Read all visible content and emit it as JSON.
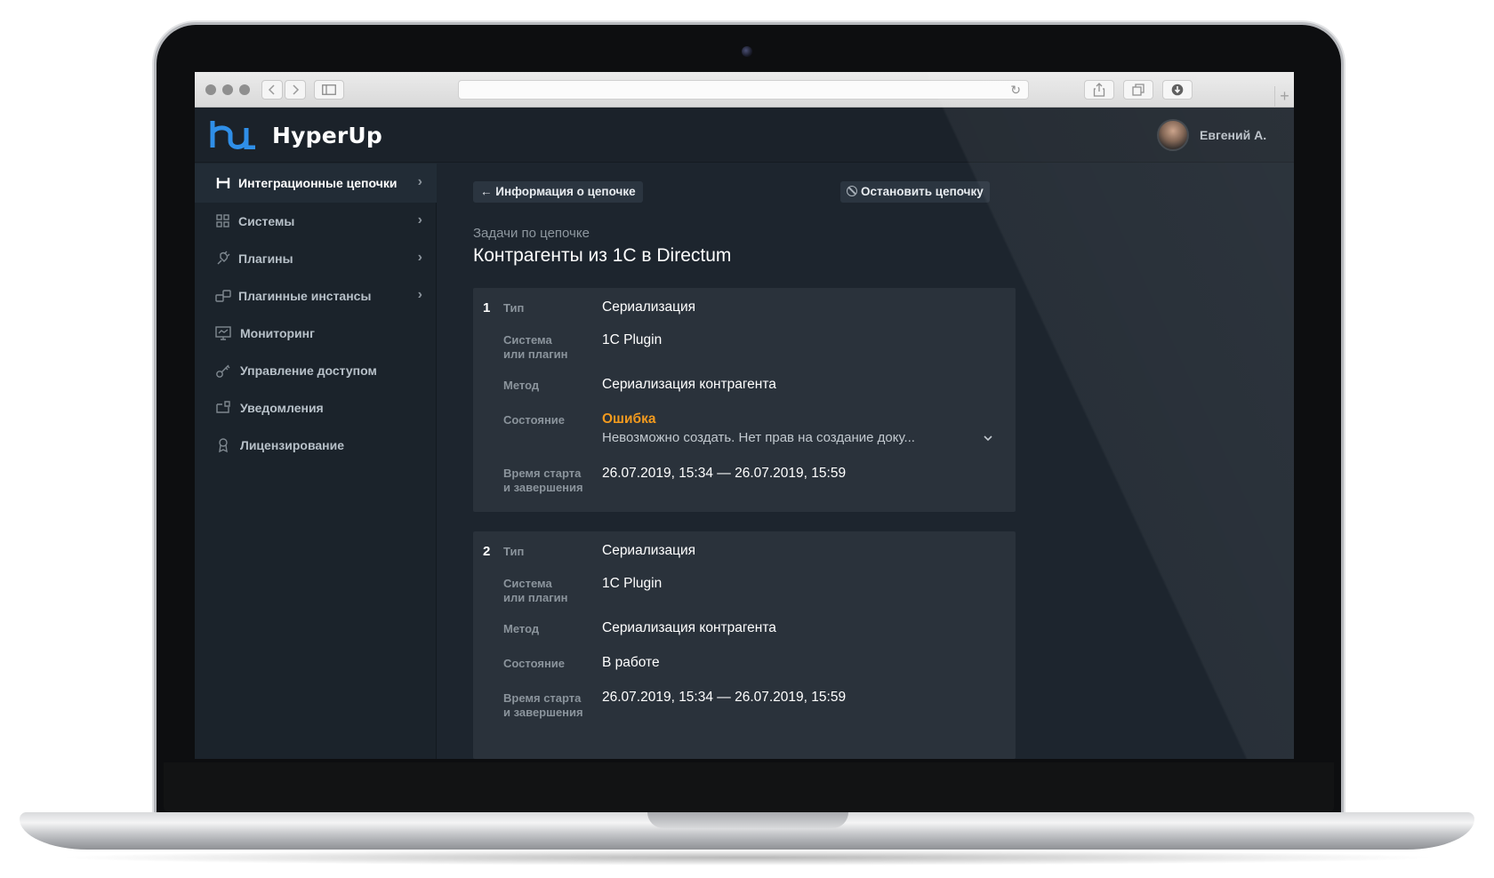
{
  "app": {
    "name": "HyperUp"
  },
  "user": {
    "name": "Евгений А."
  },
  "browser": {
    "add_tab": "+"
  },
  "sidebar": {
    "items": [
      {
        "label": "Интеграционные цепочки",
        "active": true,
        "has_chevron": true
      },
      {
        "label": "Системы",
        "has_chevron": true
      },
      {
        "label": "Плагины",
        "has_chevron": true
      },
      {
        "label": "Плагинные инстансы",
        "has_chevron": true
      },
      {
        "label": "Мониторинг",
        "has_chevron": false
      },
      {
        "label": "Управление доступом",
        "has_chevron": false
      },
      {
        "label": "Уведомления",
        "has_chevron": false
      },
      {
        "label": "Лицензирование",
        "has_chevron": false
      }
    ]
  },
  "toolbar": {
    "back_label": "Информация о цепочке",
    "stop_label": "Остановить цепочку"
  },
  "page": {
    "subtitle": "Задачи по цепочке",
    "title": "Контрагенты из 1С в Directum"
  },
  "labels": {
    "type": "Тип",
    "system_line1": "Система",
    "system_line2": "или плагин",
    "method": "Метод",
    "state": "Состояние",
    "time_line1": "Время старта",
    "time_line2": "и завершения"
  },
  "tasks": [
    {
      "number": "1",
      "type": "Сериализация",
      "system": "1C Plugin",
      "method": "Сериализация контрагента",
      "state": "Ошибка",
      "state_detail": "Невозможно создать. Нет прав на создание доку...",
      "time": "26.07.2019, 15:34 — 26.07.2019, 15:59"
    },
    {
      "number": "2",
      "type": "Сериализация",
      "system": "1C Plugin",
      "method": "Сериализация контрагента",
      "state": "В работе",
      "time": "26.07.2019, 15:34 — 26.07.2019, 15:59"
    }
  ],
  "colors": {
    "accent_blue": "#2f8fe8",
    "error_orange": "#f29a1e",
    "background": "#1d252e",
    "card": "#2a323b"
  },
  "icons": {
    "logo": "hu-logo-icon",
    "chain": "chain-icon",
    "systems": "grid-icon",
    "plugins": "plug-icon",
    "instances": "link-icon",
    "monitoring": "monitor-icon",
    "access": "key-icon",
    "notifications": "bell-icon",
    "licensing": "badge-icon"
  }
}
